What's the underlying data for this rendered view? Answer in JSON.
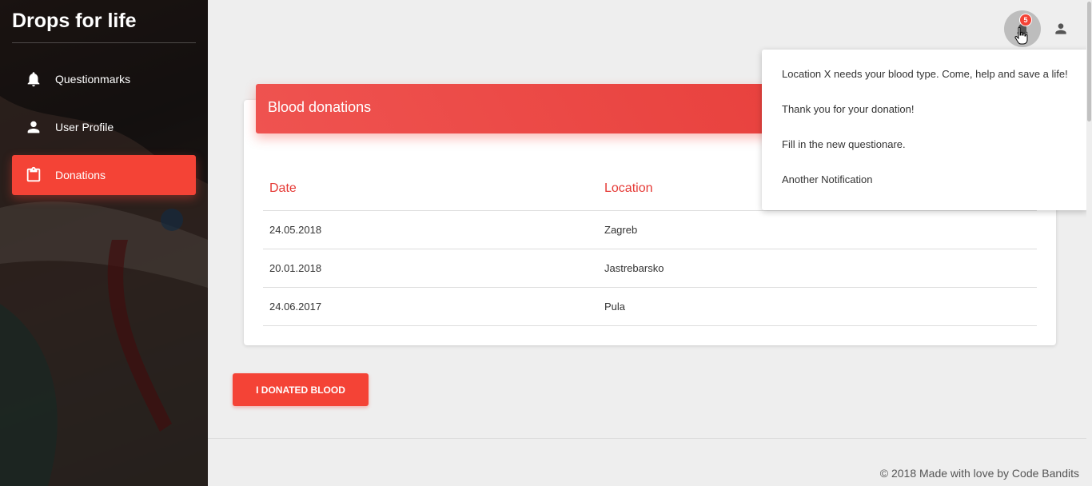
{
  "sidebar": {
    "brand": "Drops for life",
    "items": [
      {
        "label": "Questionmarks",
        "icon": "bell-icon",
        "active": false
      },
      {
        "label": "User Profile",
        "icon": "person-icon",
        "active": false
      },
      {
        "label": "Donations",
        "icon": "clipboard-icon",
        "active": true
      }
    ]
  },
  "topbar": {
    "notification_count": "5"
  },
  "card": {
    "title": "Blood donations",
    "columns": [
      "Date",
      "Location"
    ],
    "rows": [
      {
        "date": "24.05.2018",
        "location": "Zagreb"
      },
      {
        "date": "20.01.2018",
        "location": "Jastrebarsko"
      },
      {
        "date": "24.06.2017",
        "location": "Pula"
      }
    ]
  },
  "actions": {
    "donate_label": "I DONATED BLOOD"
  },
  "notifications": [
    "Location X needs your blood type. Come, help and save a life!",
    "Thank you for your donation!",
    "Fill in the new questionare.",
    "Another Notification"
  ],
  "footer": {
    "text": "© 2018 Made with love by Code Bandits"
  },
  "colors": {
    "accent": "#f44336",
    "header_gradient_start": "#ef5350",
    "header_gradient_end": "#e53935",
    "background": "#eeeeee"
  }
}
